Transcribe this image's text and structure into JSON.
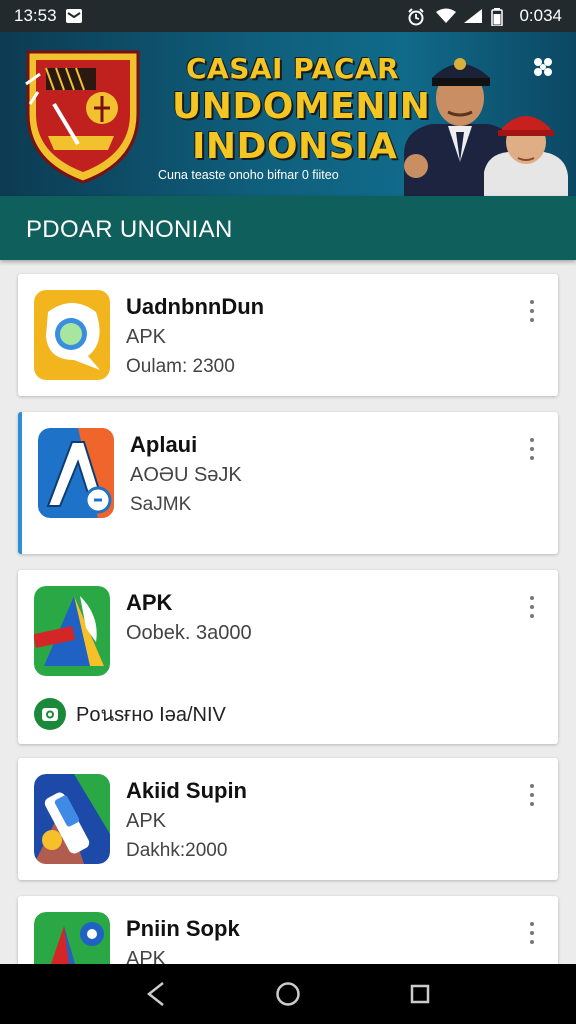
{
  "status_bar": {
    "time": "13:53",
    "clock": "0:034",
    "icons": [
      "notification-icon",
      "alarm-icon",
      "wifi-icon",
      "signal-icon",
      "battery-icon"
    ]
  },
  "banner": {
    "line1": "CASAI PACAR",
    "line2": "UNDOMENIN",
    "line3": "INDONSIA",
    "tagline": "Cuna teaste onoho bifnar 0 fiiteo",
    "close_icon": "close-icon"
  },
  "toolbar": {
    "title": "PDOAR UNONIAN"
  },
  "apps": [
    {
      "name": "UadnbnnDun",
      "line1": "APK",
      "line2": "Oulam: 2300",
      "icon": "chat-bubble-app-icon"
    },
    {
      "name": "Aplaui",
      "line1": "AOƏU SəJK",
      "line2": "SaJMK",
      "icon": "letter-a-app-icon"
    },
    {
      "name": "APK",
      "line1": "Oobek. 3a000",
      "line2": "",
      "footer": "Poนsғно Iəa/NIV",
      "icon": "play-style-app-icon"
    },
    {
      "name": "Akiid Supin",
      "line1": "APK",
      "line2": "Dakhk:2000",
      "icon": "pen-app-icon"
    },
    {
      "name": "Pniin Sopk",
      "line1": "APK",
      "line2": "",
      "icon": "gear-app-icon"
    }
  ],
  "colors": {
    "toolbar": "#0f5f5c",
    "banner_text": "#f3c623",
    "selected_accent": "#2a8fd6"
  }
}
